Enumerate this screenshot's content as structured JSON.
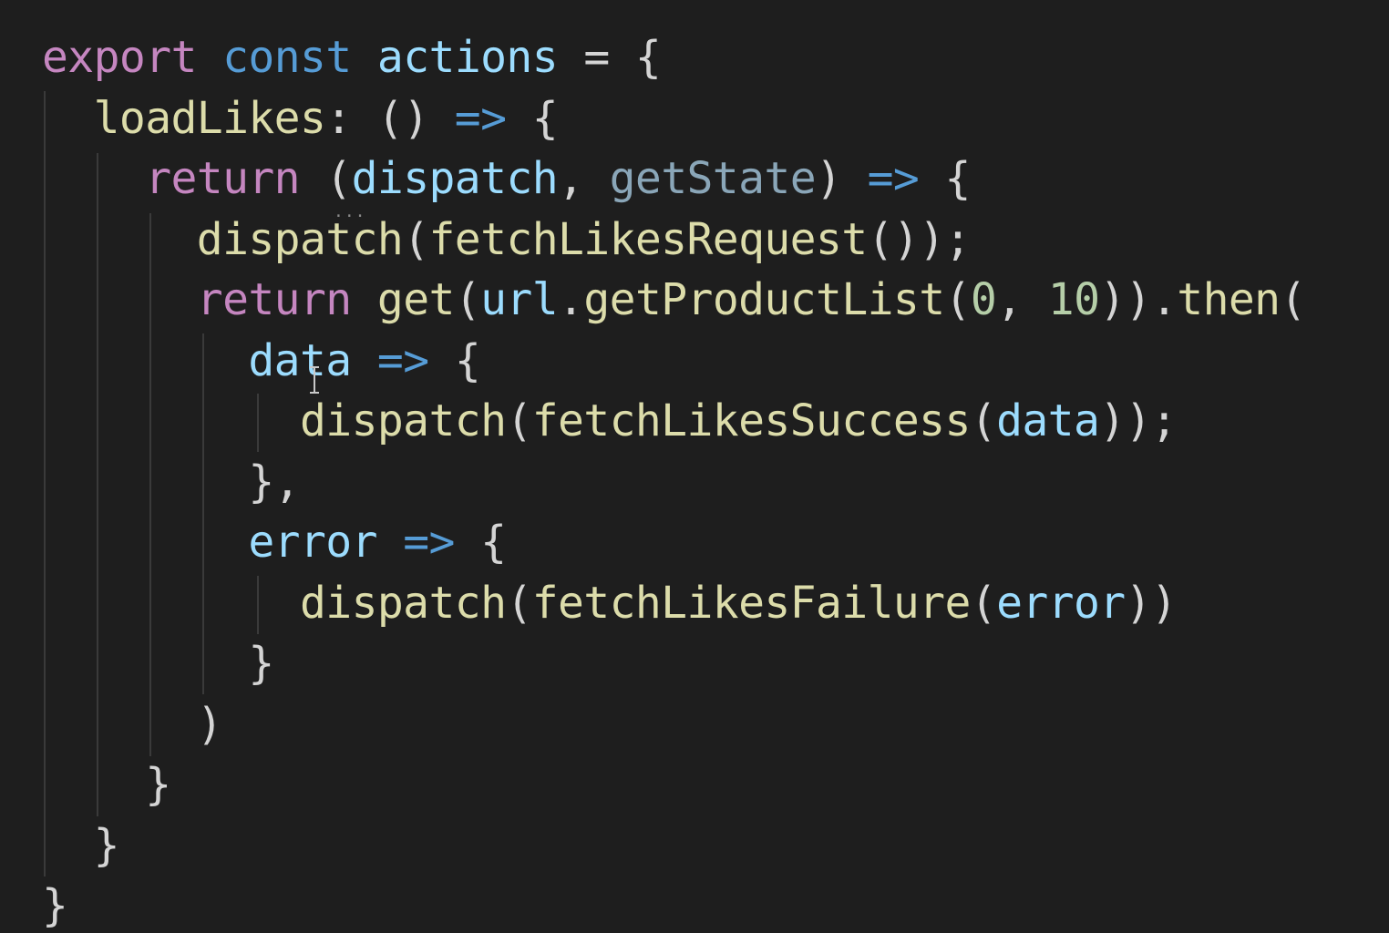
{
  "editor": {
    "language": "javascript",
    "theme": "dark",
    "background": "#1e1e1e",
    "lines": [
      [
        {
          "t": "export",
          "c": "kw-ctrl"
        },
        {
          "t": " ",
          "c": "punc"
        },
        {
          "t": "const",
          "c": "kw-decl"
        },
        {
          "t": " ",
          "c": "punc"
        },
        {
          "t": "actions",
          "c": "var"
        },
        {
          "t": " = {",
          "c": "punc"
        }
      ],
      [
        {
          "t": "  loadLikes",
          "c": "fn"
        },
        {
          "t": ": () ",
          "c": "punc"
        },
        {
          "t": "=>",
          "c": "kw-decl"
        },
        {
          "t": " {",
          "c": "punc"
        }
      ],
      [
        {
          "t": "    return",
          "c": "kw-ctrl"
        },
        {
          "t": " (",
          "c": "punc"
        },
        {
          "t": "dispatch",
          "c": "var"
        },
        {
          "t": ", ",
          "c": "punc"
        },
        {
          "t": "getState",
          "c": "dim"
        },
        {
          "t": ") ",
          "c": "punc"
        },
        {
          "t": "=>",
          "c": "kw-decl"
        },
        {
          "t": " {",
          "c": "punc"
        }
      ],
      [
        {
          "t": "      dispatch",
          "c": "fn"
        },
        {
          "t": "(",
          "c": "punc"
        },
        {
          "t": "fetchLikesRequest",
          "c": "fn"
        },
        {
          "t": "());",
          "c": "punc"
        }
      ],
      [
        {
          "t": "      return",
          "c": "kw-ctrl"
        },
        {
          "t": " ",
          "c": "punc"
        },
        {
          "t": "get",
          "c": "fn"
        },
        {
          "t": "(",
          "c": "punc"
        },
        {
          "t": "url",
          "c": "var"
        },
        {
          "t": ".",
          "c": "punc"
        },
        {
          "t": "getProductList",
          "c": "fn"
        },
        {
          "t": "(",
          "c": "punc"
        },
        {
          "t": "0",
          "c": "num"
        },
        {
          "t": ", ",
          "c": "punc"
        },
        {
          "t": "10",
          "c": "num"
        },
        {
          "t": ")).",
          "c": "punc"
        },
        {
          "t": "then",
          "c": "fn"
        },
        {
          "t": "(",
          "c": "punc"
        }
      ],
      [
        {
          "t": "        data",
          "c": "var"
        },
        {
          "t": " ",
          "c": "punc"
        },
        {
          "t": "=>",
          "c": "kw-decl"
        },
        {
          "t": " {",
          "c": "punc"
        }
      ],
      [
        {
          "t": "          dispatch",
          "c": "fn"
        },
        {
          "t": "(",
          "c": "punc"
        },
        {
          "t": "fetchLikesSuccess",
          "c": "fn"
        },
        {
          "t": "(",
          "c": "punc"
        },
        {
          "t": "data",
          "c": "var"
        },
        {
          "t": "));",
          "c": "punc"
        }
      ],
      [
        {
          "t": "        },",
          "c": "punc"
        }
      ],
      [
        {
          "t": "        error",
          "c": "var"
        },
        {
          "t": " ",
          "c": "punc"
        },
        {
          "t": "=>",
          "c": "kw-decl"
        },
        {
          "t": " {",
          "c": "punc"
        }
      ],
      [
        {
          "t": "          dispatch",
          "c": "fn"
        },
        {
          "t": "(",
          "c": "punc"
        },
        {
          "t": "fetchLikesFailure",
          "c": "fn"
        },
        {
          "t": "(",
          "c": "punc"
        },
        {
          "t": "error",
          "c": "var"
        },
        {
          "t": "))",
          "c": "punc"
        }
      ],
      [
        {
          "t": "        }",
          "c": "punc"
        }
      ],
      [
        {
          "t": "      )",
          "c": "punc"
        }
      ],
      [
        {
          "t": "    }",
          "c": "punc"
        }
      ],
      [
        {
          "t": "  }",
          "c": "punc"
        }
      ],
      [
        {
          "t": "}",
          "c": "punc"
        }
      ]
    ],
    "hint_ellipsis": "..."
  }
}
